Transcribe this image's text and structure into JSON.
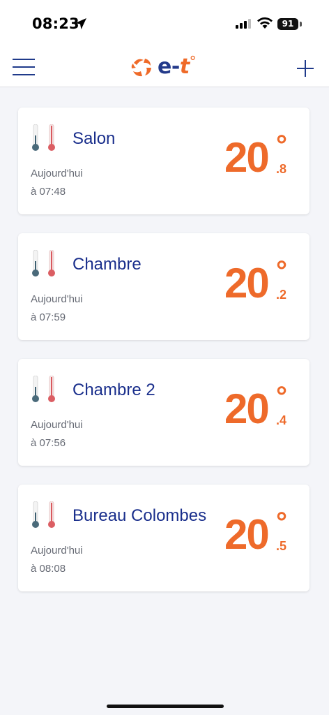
{
  "status_bar": {
    "time": "08:23",
    "battery": "91"
  },
  "header": {
    "logo_text": "e-",
    "logo_t": "t",
    "logo_degree": "°"
  },
  "rooms": [
    {
      "name": "Salon",
      "date": "Aujourd'hui",
      "time": "à 07:48",
      "temp_int": "20",
      "temp_dec": ".8",
      "degree": "°"
    },
    {
      "name": "Chambre",
      "date": "Aujourd'hui",
      "time": "à 07:59",
      "temp_int": "20",
      "temp_dec": ".2",
      "degree": "°"
    },
    {
      "name": "Chambre 2",
      "date": "Aujourd'hui",
      "time": "à 07:56",
      "temp_int": "20",
      "temp_dec": ".4",
      "degree": "°"
    },
    {
      "name": "Bureau Colombes",
      "date": "Aujourd'hui",
      "time": "à 08:08",
      "temp_int": "20",
      "temp_dec": ".5",
      "degree": "°"
    }
  ],
  "colors": {
    "accent": "#ee6a2a",
    "brand_blue": "#1a2f8c",
    "background": "#f4f5f9"
  },
  "icons": {
    "menu": "hamburger-menu-icon",
    "add": "plus-icon",
    "thermometer": "thermometer-icon"
  }
}
